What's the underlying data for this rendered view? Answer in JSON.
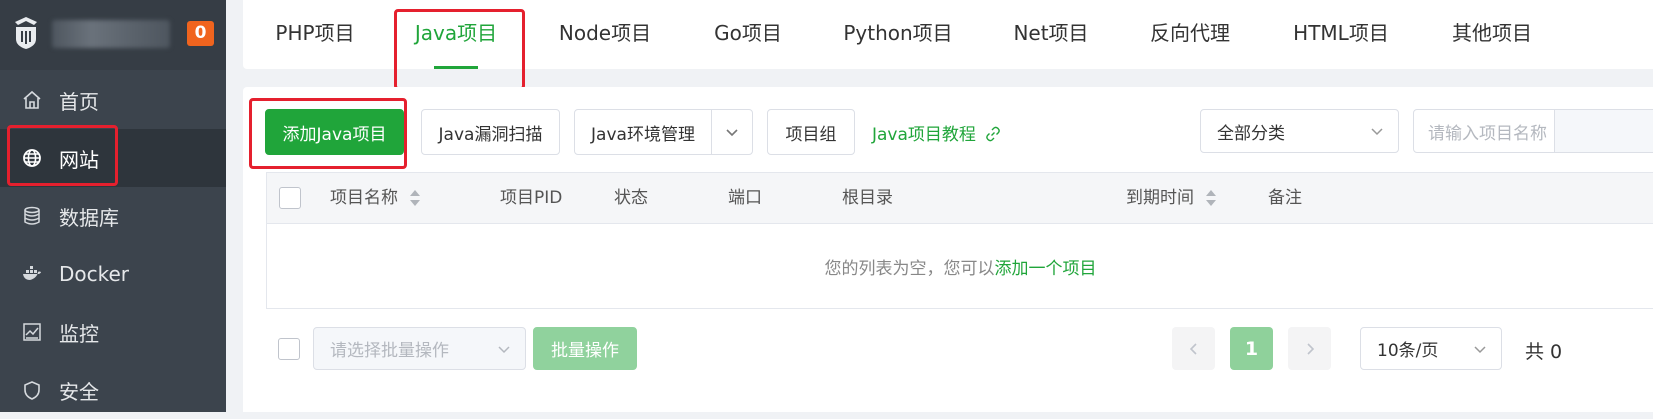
{
  "sidebar": {
    "badge": "0",
    "items": [
      {
        "label": "首页",
        "icon": "home-icon"
      },
      {
        "label": "网站",
        "icon": "globe-icon"
      },
      {
        "label": "数据库",
        "icon": "database-icon"
      },
      {
        "label": "Docker",
        "icon": "docker-icon"
      },
      {
        "label": "监控",
        "icon": "monitor-icon"
      },
      {
        "label": "安全",
        "icon": "shield-icon"
      }
    ]
  },
  "tabs": [
    {
      "label": "PHP项目"
    },
    {
      "label": "Java项目"
    },
    {
      "label": "Node项目"
    },
    {
      "label": "Go项目"
    },
    {
      "label": "Python项目"
    },
    {
      "label": "Net项目"
    },
    {
      "label": "反向代理"
    },
    {
      "label": "HTML项目"
    },
    {
      "label": "其他项目"
    }
  ],
  "toolbar": {
    "add_label": "添加Java项目",
    "scan_label": "Java漏洞扫描",
    "env_label": "Java环境管理",
    "group_label": "项目组",
    "tutorial_label": "Java项目教程",
    "category_value": "全部分类",
    "search_placeholder": "请输入项目名称"
  },
  "table": {
    "columns": [
      "项目名称",
      "项目PID",
      "状态",
      "端口",
      "根目录",
      "到期时间",
      "备注"
    ],
    "empty_text": "您的列表为空，您可以",
    "empty_link": "添加一个项目"
  },
  "footer": {
    "batch_placeholder": "请选择批量操作",
    "batch_button": "批量操作",
    "current_page": "1",
    "page_size": "10条/页",
    "total": "共 0"
  },
  "colors": {
    "accent": "#20a53a",
    "sidebar_bg": "#3c444d",
    "badge": "#f0641e",
    "highlight": "#e5202e"
  }
}
